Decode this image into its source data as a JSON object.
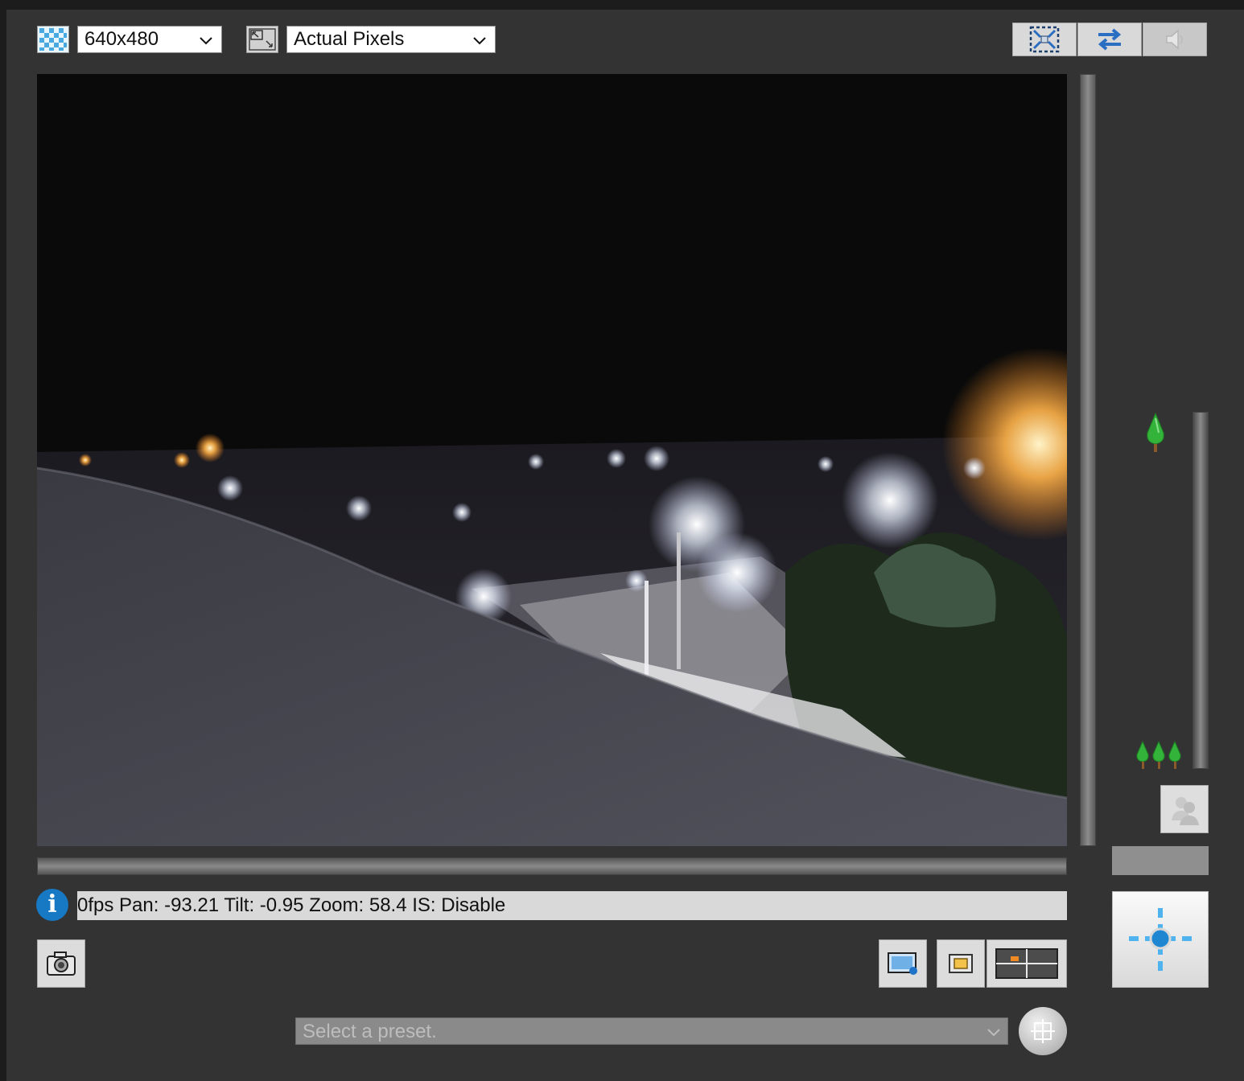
{
  "toolbar": {
    "resolution": {
      "value": "640x480",
      "icon": "checker-grid-icon"
    },
    "view_size": {
      "value": "Actual Pixels",
      "icon": "resize-window-icon"
    },
    "buttons": [
      {
        "name": "fullscreen-icon"
      },
      {
        "name": "swap-arrows-icon"
      },
      {
        "name": "speaker-icon"
      }
    ]
  },
  "status": {
    "text": "0fps Pan: -93.21 Tilt: -0.95 Zoom: 58.4 IS: Disable",
    "icon": "info-icon",
    "icon_glyph": "i"
  },
  "preset": {
    "placeholder": "Select a preset."
  },
  "colors": {
    "background": "#333333",
    "info_blue": "#1778c4",
    "tree_green": "#33b33a"
  }
}
